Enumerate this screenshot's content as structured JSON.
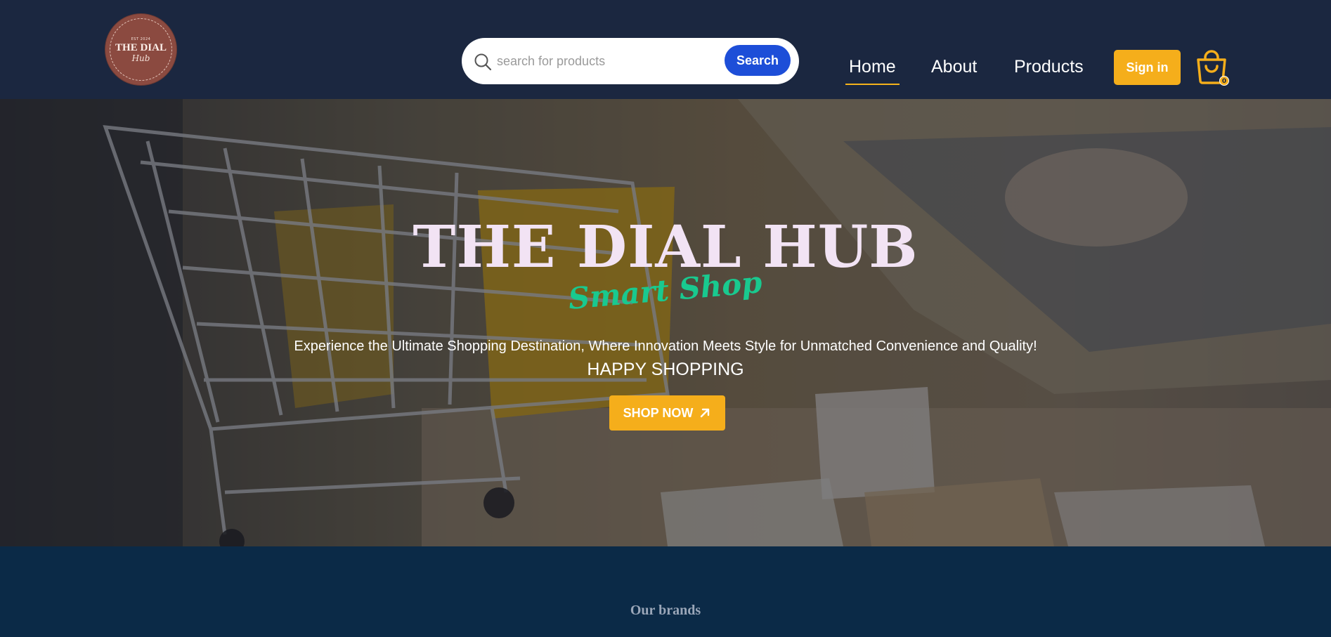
{
  "header": {
    "logo": {
      "est": "EST 2024",
      "name": "THE DIAL",
      "sub": "Hub"
    },
    "search": {
      "placeholder": "search for products",
      "button_label": "Search",
      "icon": "search-icon"
    },
    "nav": {
      "items": [
        {
          "label": "Home",
          "active": true
        },
        {
          "label": "About",
          "active": false
        },
        {
          "label": "Products",
          "active": false
        }
      ]
    },
    "signin_label": "Sign in",
    "cart": {
      "icon": "shopping-bag-icon",
      "count": "0"
    }
  },
  "hero": {
    "title": "THE DIAL HUB",
    "script": "Smart Shop",
    "tagline": "Experience the Ultimate Shopping Destination, Where Innovation Meets Style for Unmatched Convenience and Quality!",
    "happy": "HAPPY SHOPPING",
    "cta_label": "SHOP NOW",
    "cta_icon": "arrow-up-right-icon"
  },
  "brands": {
    "title": "Our brands"
  },
  "colors": {
    "header_bg": "#1b2740",
    "accent": "#f5ae1b",
    "search_button": "#1d4ed8",
    "script_green": "#19c98f",
    "title_pink": "#f2e3f4",
    "brands_bg": "#0b2a47"
  }
}
